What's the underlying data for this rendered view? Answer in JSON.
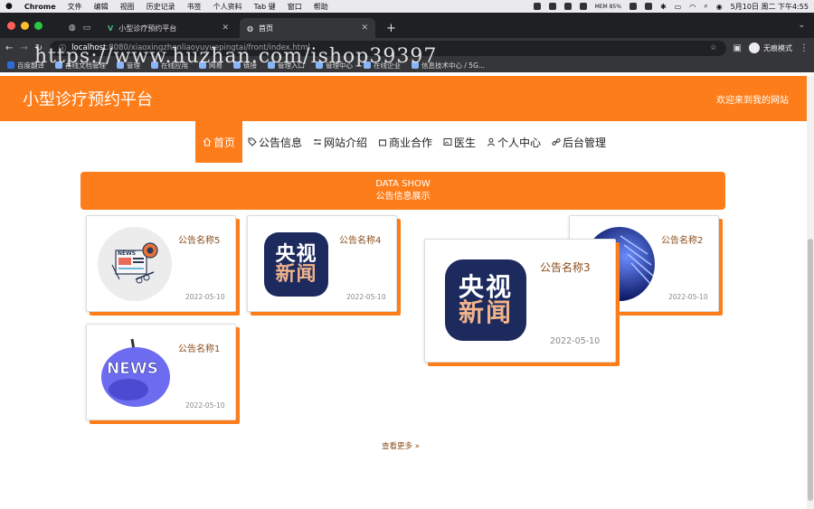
{
  "mac_menu": {
    "app": "Chrome",
    "items": [
      "文件",
      "编辑",
      "视图",
      "历史记录",
      "书签",
      "个人资料",
      "Tab 键",
      "窗口",
      "帮助"
    ],
    "mem": "MEM 85%",
    "clock": "5月10日 周二 下午4:55"
  },
  "tabs": [
    {
      "title": "小型诊疗预约平台"
    },
    {
      "title": "首页"
    }
  ],
  "address": {
    "host": "localhost",
    "path": ":8080/xiaoxingzhenliaoyuyuepingtai/front/index.html",
    "profile": "无痕模式"
  },
  "bookmarks": [
    "百度翻译",
    "在线文档管理",
    "管理",
    "在线应用",
    "网易",
    "链接",
    "管理入口",
    "管理中心",
    "在线企业",
    "信息技术中心 / 5G..."
  ],
  "watermark": "https://www.huzhan.com/ishop39397",
  "site": {
    "title": "小型诊疗预约平台",
    "welcome": "欢迎来到我的网站"
  },
  "nav": [
    {
      "label": "首页",
      "icon": "home-icon"
    },
    {
      "label": "公告信息",
      "icon": "tag-icon"
    },
    {
      "label": "网站介绍",
      "icon": "sliders-icon"
    },
    {
      "label": "商业合作",
      "icon": "building-icon"
    },
    {
      "label": "医生",
      "icon": "image-icon"
    },
    {
      "label": "个人中心",
      "icon": "user-icon"
    },
    {
      "label": "后台管理",
      "icon": "link-icon"
    }
  ],
  "section": {
    "title_en": "DATA SHOW",
    "title_cn": "公告信息展示"
  },
  "cards": [
    {
      "name": "公告名称5",
      "date": "2022-05-10"
    },
    {
      "name": "公告名称4",
      "date": "2022-05-10"
    },
    {
      "name": "公告名称3",
      "date": "2022-05-10"
    },
    {
      "name": "公告名称2",
      "date": "2022-05-10"
    },
    {
      "name": "公告名称1",
      "date": "2022-05-10"
    }
  ],
  "cctv_text": [
    "央视",
    "新闻"
  ],
  "news_text": "NEWS",
  "more_label": "查看更多 »",
  "colors": {
    "accent": "#fd7d1a",
    "card_title": "#8a4d1a"
  }
}
